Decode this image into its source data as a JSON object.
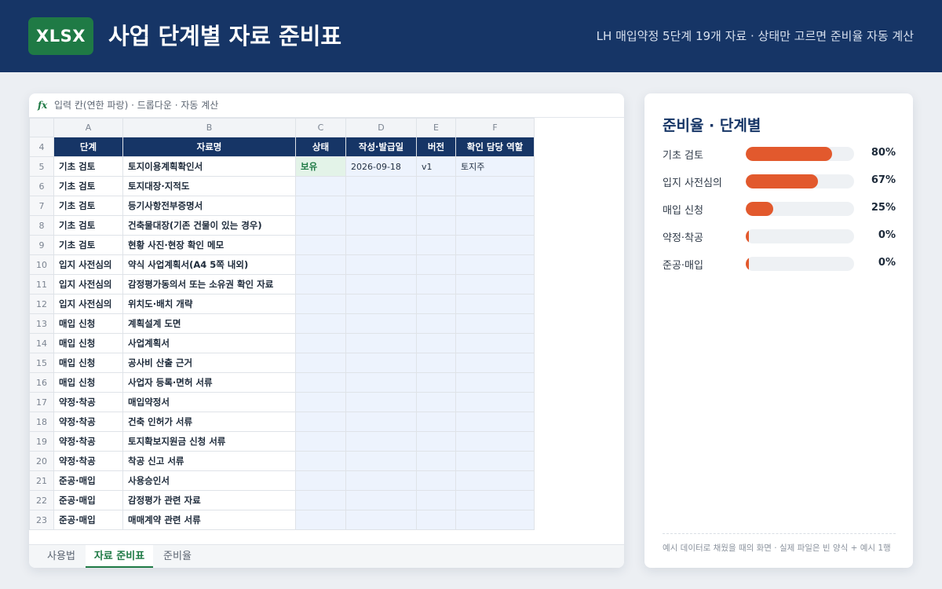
{
  "header": {
    "badge": "XLSX",
    "title": "사업 단계별 자료 준비표",
    "subtitle": "LH 매입약정 5단계 19개 자료 · 상태만 고르면 준비율 자동 계산"
  },
  "formula_bar": {
    "fx": "fx",
    "text": "입력 칸(연한 파랑) · 드롭다운 · 자동 계산"
  },
  "sheet": {
    "columns": [
      "A",
      "B",
      "C",
      "D",
      "E",
      "F"
    ],
    "header_row_number": "4",
    "headers": [
      "단계",
      "자료명",
      "상태",
      "작성·발급일",
      "버전",
      "확인 담당 역할"
    ],
    "rows": [
      {
        "num": "5",
        "stage": "기초 검토",
        "doc": "토지이용계획확인서",
        "status": "보유",
        "date": "2026-09-18",
        "version": "v1",
        "owner": "토지주"
      },
      {
        "num": "6",
        "stage": "기초 검토",
        "doc": "토지대장·지적도",
        "status": "",
        "date": "",
        "version": "",
        "owner": ""
      },
      {
        "num": "7",
        "stage": "기초 검토",
        "doc": "등기사항전부증명서",
        "status": "",
        "date": "",
        "version": "",
        "owner": ""
      },
      {
        "num": "8",
        "stage": "기초 검토",
        "doc": "건축물대장(기존 건물이 있는 경우)",
        "status": "",
        "date": "",
        "version": "",
        "owner": ""
      },
      {
        "num": "9",
        "stage": "기초 검토",
        "doc": "현황 사진·현장 확인 메모",
        "status": "",
        "date": "",
        "version": "",
        "owner": ""
      },
      {
        "num": "10",
        "stage": "입지 사전심의",
        "doc": "약식 사업계획서(A4 5쪽 내외)",
        "status": "",
        "date": "",
        "version": "",
        "owner": ""
      },
      {
        "num": "11",
        "stage": "입지 사전심의",
        "doc": "감정평가동의서 또는 소유권 확인 자료",
        "status": "",
        "date": "",
        "version": "",
        "owner": ""
      },
      {
        "num": "12",
        "stage": "입지 사전심의",
        "doc": "위치도·배치 개략",
        "status": "",
        "date": "",
        "version": "",
        "owner": ""
      },
      {
        "num": "13",
        "stage": "매입 신청",
        "doc": "계획설계 도면",
        "status": "",
        "date": "",
        "version": "",
        "owner": ""
      },
      {
        "num": "14",
        "stage": "매입 신청",
        "doc": "사업계획서",
        "status": "",
        "date": "",
        "version": "",
        "owner": ""
      },
      {
        "num": "15",
        "stage": "매입 신청",
        "doc": "공사비 산출 근거",
        "status": "",
        "date": "",
        "version": "",
        "owner": ""
      },
      {
        "num": "16",
        "stage": "매입 신청",
        "doc": "사업자 등록·면허 서류",
        "status": "",
        "date": "",
        "version": "",
        "owner": ""
      },
      {
        "num": "17",
        "stage": "약정·착공",
        "doc": "매입약정서",
        "status": "",
        "date": "",
        "version": "",
        "owner": ""
      },
      {
        "num": "18",
        "stage": "약정·착공",
        "doc": "건축 인허가 서류",
        "status": "",
        "date": "",
        "version": "",
        "owner": ""
      },
      {
        "num": "19",
        "stage": "약정·착공",
        "doc": "토지확보지원금 신청 서류",
        "status": "",
        "date": "",
        "version": "",
        "owner": ""
      },
      {
        "num": "20",
        "stage": "약정·착공",
        "doc": "착공 신고 서류",
        "status": "",
        "date": "",
        "version": "",
        "owner": ""
      },
      {
        "num": "21",
        "stage": "준공·매입",
        "doc": "사용승인서",
        "status": "",
        "date": "",
        "version": "",
        "owner": ""
      },
      {
        "num": "22",
        "stage": "준공·매입",
        "doc": "감정평가 관련 자료",
        "status": "",
        "date": "",
        "version": "",
        "owner": ""
      },
      {
        "num": "23",
        "stage": "준공·매입",
        "doc": "매매계약 관련 서류",
        "status": "",
        "date": "",
        "version": "",
        "owner": ""
      }
    ]
  },
  "tabs": [
    {
      "label": "사용법",
      "active": false
    },
    {
      "label": "자료 준비표",
      "active": true
    },
    {
      "label": "준비율",
      "active": false
    }
  ],
  "panel": {
    "title": "준비율 · 단계별",
    "stages": [
      {
        "label": "기초 검토",
        "percent": 80,
        "percent_label": "80%"
      },
      {
        "label": "입지 사전심의",
        "percent": 67,
        "percent_label": "67%"
      },
      {
        "label": "매입 신청",
        "percent": 25,
        "percent_label": "25%"
      },
      {
        "label": "약정·착공",
        "percent": 0,
        "percent_label": "0%"
      },
      {
        "label": "준공·매입",
        "percent": 0,
        "percent_label": "0%"
      }
    ],
    "note": "예시 데이터로 채웠을 때의 화면 · 실제 파일은 빈 양식 + 예시 1행"
  },
  "colors": {
    "header_bg": "#163566",
    "excel_green": "#1f7a45",
    "input_blue": "#edf3fd",
    "bar_fill": "#e2592d"
  }
}
